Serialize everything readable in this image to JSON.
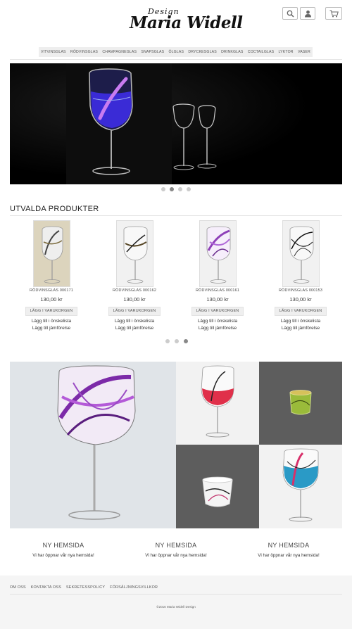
{
  "brand": {
    "design": "Design",
    "name": "Maria Widell"
  },
  "header": {
    "search_icon": "search-icon",
    "account_icon": "user-icon",
    "cart_icon": "cart-icon"
  },
  "nav": {
    "items": [
      "VITVINSGLAS",
      "RÖDVINSGLAS",
      "CHAMPAGNEGLAS",
      "SNAPSGLAS",
      "ÖLGLAS",
      "DRYCKESGLAS",
      "DRINKGLAS",
      "COCTAILGLAS",
      "LYKTOR",
      "VASER"
    ]
  },
  "hero": {
    "slides": 4,
    "active_slide": 2
  },
  "featured": {
    "title": "UTVALDA PRODUKTER",
    "products": [
      {
        "name": "RÖDVINSGLAS 000171",
        "price": "130,00 kr",
        "button": "LÄGG I VARUKORGEN",
        "wishlist": "Lägg till i önskelista",
        "compare": "Lägg till jämförelse"
      },
      {
        "name": "RÖDVINSGLAS 000162",
        "price": "130,00 kr",
        "button": "LÄGG I VARUKORGEN",
        "wishlist": "Lägg till i önskelista",
        "compare": "Lägg till jämförelse"
      },
      {
        "name": "RÖDVINSGLAS 000161",
        "price": "130,00 kr",
        "button": "LÄGG I VARUKORGEN",
        "wishlist": "Lägg till i önskelista",
        "compare": "Lägg till jämförelse"
      },
      {
        "name": "RÖDVINSGLAS 000153",
        "price": "130,00 kr",
        "button": "LÄGG I VARUKORGEN",
        "wishlist": "Lägg till i önskelista",
        "compare": "Lägg till jämförelse"
      }
    ],
    "pages": 3,
    "active_page": 3
  },
  "news": [
    {
      "title": "NY HEMSIDA",
      "text": "Vi har öppnar vår nya hemsida!"
    },
    {
      "title": "NY HEMSIDA",
      "text": "Vi har öppnar vår nya hemsida!"
    },
    {
      "title": "NY HEMSIDA",
      "text": "Vi har öppnar vår nya hemsida!"
    }
  ],
  "footer": {
    "links": [
      "OM OSS",
      "KONTAKTA OSS",
      "SEKRETESSPOLICY",
      "FÖRSÄLJNINGSVILLKOR"
    ],
    "copyright": "©2016 Maria Widell Design"
  },
  "colors": {
    "nav_bg": "#eeeeee",
    "hero_bg": "#000000",
    "tile_dark": "#5d5d5d",
    "tile_light": "#f2f2f2",
    "footer_bg": "#f5f5f5"
  }
}
